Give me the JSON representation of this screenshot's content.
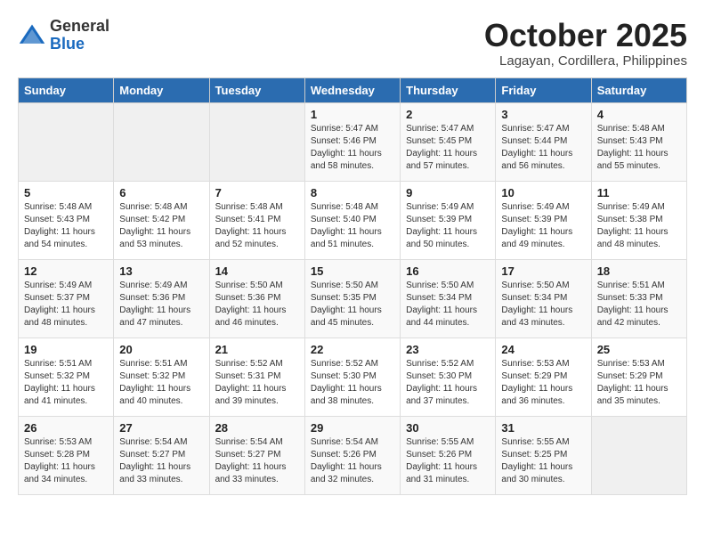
{
  "header": {
    "logo_general": "General",
    "logo_blue": "Blue",
    "month": "October 2025",
    "location": "Lagayan, Cordillera, Philippines"
  },
  "days_of_week": [
    "Sunday",
    "Monday",
    "Tuesday",
    "Wednesday",
    "Thursday",
    "Friday",
    "Saturday"
  ],
  "weeks": [
    [
      {
        "day": "",
        "content": ""
      },
      {
        "day": "",
        "content": ""
      },
      {
        "day": "",
        "content": ""
      },
      {
        "day": "1",
        "content": "Sunrise: 5:47 AM\nSunset: 5:46 PM\nDaylight: 11 hours\nand 58 minutes."
      },
      {
        "day": "2",
        "content": "Sunrise: 5:47 AM\nSunset: 5:45 PM\nDaylight: 11 hours\nand 57 minutes."
      },
      {
        "day": "3",
        "content": "Sunrise: 5:47 AM\nSunset: 5:44 PM\nDaylight: 11 hours\nand 56 minutes."
      },
      {
        "day": "4",
        "content": "Sunrise: 5:48 AM\nSunset: 5:43 PM\nDaylight: 11 hours\nand 55 minutes."
      }
    ],
    [
      {
        "day": "5",
        "content": "Sunrise: 5:48 AM\nSunset: 5:43 PM\nDaylight: 11 hours\nand 54 minutes."
      },
      {
        "day": "6",
        "content": "Sunrise: 5:48 AM\nSunset: 5:42 PM\nDaylight: 11 hours\nand 53 minutes."
      },
      {
        "day": "7",
        "content": "Sunrise: 5:48 AM\nSunset: 5:41 PM\nDaylight: 11 hours\nand 52 minutes."
      },
      {
        "day": "8",
        "content": "Sunrise: 5:48 AM\nSunset: 5:40 PM\nDaylight: 11 hours\nand 51 minutes."
      },
      {
        "day": "9",
        "content": "Sunrise: 5:49 AM\nSunset: 5:39 PM\nDaylight: 11 hours\nand 50 minutes."
      },
      {
        "day": "10",
        "content": "Sunrise: 5:49 AM\nSunset: 5:39 PM\nDaylight: 11 hours\nand 49 minutes."
      },
      {
        "day": "11",
        "content": "Sunrise: 5:49 AM\nSunset: 5:38 PM\nDaylight: 11 hours\nand 48 minutes."
      }
    ],
    [
      {
        "day": "12",
        "content": "Sunrise: 5:49 AM\nSunset: 5:37 PM\nDaylight: 11 hours\nand 48 minutes."
      },
      {
        "day": "13",
        "content": "Sunrise: 5:49 AM\nSunset: 5:36 PM\nDaylight: 11 hours\nand 47 minutes."
      },
      {
        "day": "14",
        "content": "Sunrise: 5:50 AM\nSunset: 5:36 PM\nDaylight: 11 hours\nand 46 minutes."
      },
      {
        "day": "15",
        "content": "Sunrise: 5:50 AM\nSunset: 5:35 PM\nDaylight: 11 hours\nand 45 minutes."
      },
      {
        "day": "16",
        "content": "Sunrise: 5:50 AM\nSunset: 5:34 PM\nDaylight: 11 hours\nand 44 minutes."
      },
      {
        "day": "17",
        "content": "Sunrise: 5:50 AM\nSunset: 5:34 PM\nDaylight: 11 hours\nand 43 minutes."
      },
      {
        "day": "18",
        "content": "Sunrise: 5:51 AM\nSunset: 5:33 PM\nDaylight: 11 hours\nand 42 minutes."
      }
    ],
    [
      {
        "day": "19",
        "content": "Sunrise: 5:51 AM\nSunset: 5:32 PM\nDaylight: 11 hours\nand 41 minutes."
      },
      {
        "day": "20",
        "content": "Sunrise: 5:51 AM\nSunset: 5:32 PM\nDaylight: 11 hours\nand 40 minutes."
      },
      {
        "day": "21",
        "content": "Sunrise: 5:52 AM\nSunset: 5:31 PM\nDaylight: 11 hours\nand 39 minutes."
      },
      {
        "day": "22",
        "content": "Sunrise: 5:52 AM\nSunset: 5:30 PM\nDaylight: 11 hours\nand 38 minutes."
      },
      {
        "day": "23",
        "content": "Sunrise: 5:52 AM\nSunset: 5:30 PM\nDaylight: 11 hours\nand 37 minutes."
      },
      {
        "day": "24",
        "content": "Sunrise: 5:53 AM\nSunset: 5:29 PM\nDaylight: 11 hours\nand 36 minutes."
      },
      {
        "day": "25",
        "content": "Sunrise: 5:53 AM\nSunset: 5:29 PM\nDaylight: 11 hours\nand 35 minutes."
      }
    ],
    [
      {
        "day": "26",
        "content": "Sunrise: 5:53 AM\nSunset: 5:28 PM\nDaylight: 11 hours\nand 34 minutes."
      },
      {
        "day": "27",
        "content": "Sunrise: 5:54 AM\nSunset: 5:27 PM\nDaylight: 11 hours\nand 33 minutes."
      },
      {
        "day": "28",
        "content": "Sunrise: 5:54 AM\nSunset: 5:27 PM\nDaylight: 11 hours\nand 33 minutes."
      },
      {
        "day": "29",
        "content": "Sunrise: 5:54 AM\nSunset: 5:26 PM\nDaylight: 11 hours\nand 32 minutes."
      },
      {
        "day": "30",
        "content": "Sunrise: 5:55 AM\nSunset: 5:26 PM\nDaylight: 11 hours\nand 31 minutes."
      },
      {
        "day": "31",
        "content": "Sunrise: 5:55 AM\nSunset: 5:25 PM\nDaylight: 11 hours\nand 30 minutes."
      },
      {
        "day": "",
        "content": ""
      }
    ]
  ]
}
